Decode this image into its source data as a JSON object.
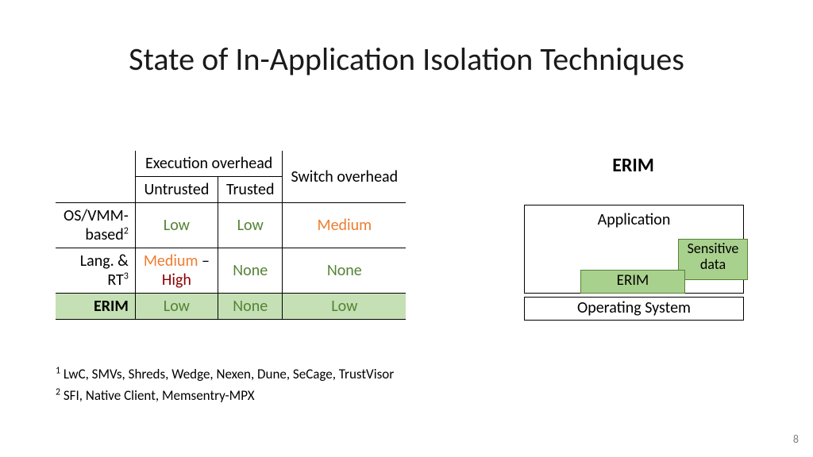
{
  "title": "State of In-Application Isolation Techniques",
  "table": {
    "headers": {
      "exec": "Execution overhead",
      "switch": "Switch overhead",
      "untrusted": "Untrusted",
      "trusted": "Trusted"
    },
    "rows": {
      "osvmm_label_a": "OS/VMM-",
      "osvmm_label_b": "based",
      "osvmm_sup": "2",
      "osvmm_unt": "Low",
      "osvmm_tru": "Low",
      "osvmm_sw": "Medium",
      "lang_label_a": "Lang. &",
      "lang_label_b": "RT",
      "lang_sup": "3",
      "lang_unt_a": "Medium",
      "lang_unt_dash": " – ",
      "lang_unt_b": "High",
      "lang_tru": "None",
      "lang_sw": "None",
      "erim_label": "ERIM",
      "erim_unt": "Low",
      "erim_tru": "None",
      "erim_sw": "Low"
    }
  },
  "diagram": {
    "title": "ERIM",
    "app": "Application",
    "sensitive_a": "Sensitive",
    "sensitive_b": "data",
    "erim": "ERIM",
    "os": "Operating System"
  },
  "footnotes": {
    "f1_sup": "1",
    "f1": " LwC, SMVs, Shreds, Wedge, Nexen, Dune, SeCage, TrustVisor",
    "f2_sup": "2",
    "f2": " SFI, Native Client, Memsentry-MPX"
  },
  "pagenum": "8"
}
